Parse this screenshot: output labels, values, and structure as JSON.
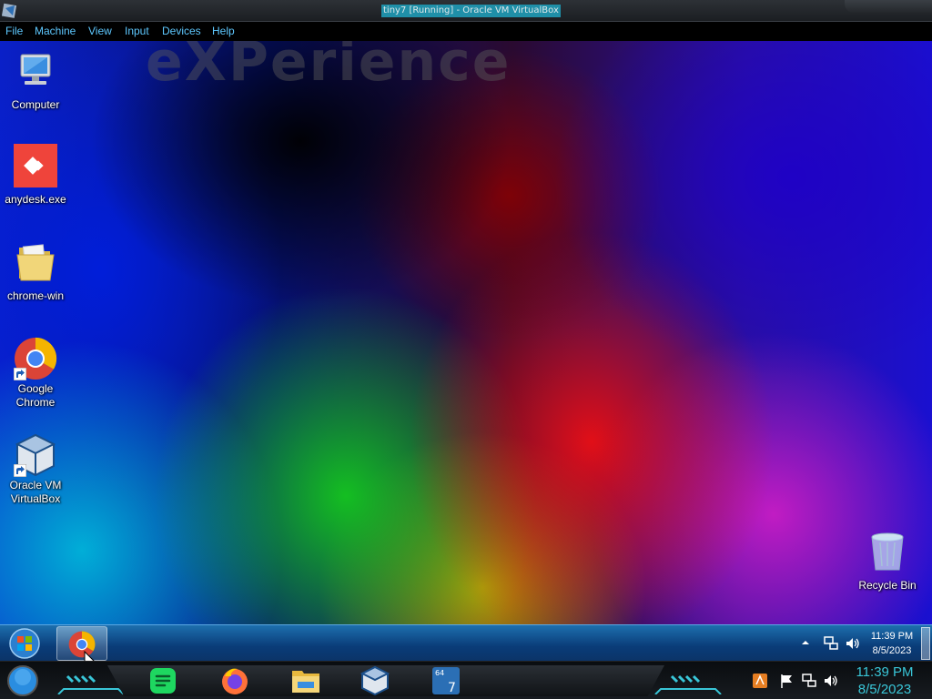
{
  "host_window": {
    "title": "tiny7 [Running] - Oracle VM VirtualBox"
  },
  "vbox_menu": {
    "items": [
      "File",
      "Machine",
      "View",
      "Input",
      "Devices",
      "Help"
    ]
  },
  "wallpaper": {
    "watermark": "eXPerience"
  },
  "desktop_icons": [
    {
      "label": "Computer",
      "icon": "computer-icon"
    },
    {
      "label": "anydesk.exe",
      "icon": "anydesk-icon"
    },
    {
      "label": "chrome-win",
      "icon": "folder-icon"
    },
    {
      "label": "Google Chrome",
      "icon": "chrome-icon"
    },
    {
      "label": "Oracle VM VirtualBox",
      "icon": "virtualbox-icon"
    },
    {
      "label": "Recycle Bin",
      "icon": "recycle-bin-icon"
    }
  ],
  "guest_taskbar": {
    "pinned": [
      "chrome-icon"
    ],
    "clock_time": "11:39 PM",
    "clock_date": "8/5/2023"
  },
  "host_dock": {
    "apps": [
      "messages-icon",
      "firefox-icon",
      "file-explorer-icon",
      "virtualbox-icon",
      "windows7-vm-icon"
    ],
    "tray": [
      "app-icon",
      "flag-icon",
      "network-icon",
      "volume-icon"
    ],
    "clock_time": "11:39 PM",
    "clock_date": "8/5/2023"
  },
  "colors": {
    "menu_text": "#5ec8ff",
    "host_clock": "#39c6d8",
    "title_highlight": "#1f8fa8"
  }
}
